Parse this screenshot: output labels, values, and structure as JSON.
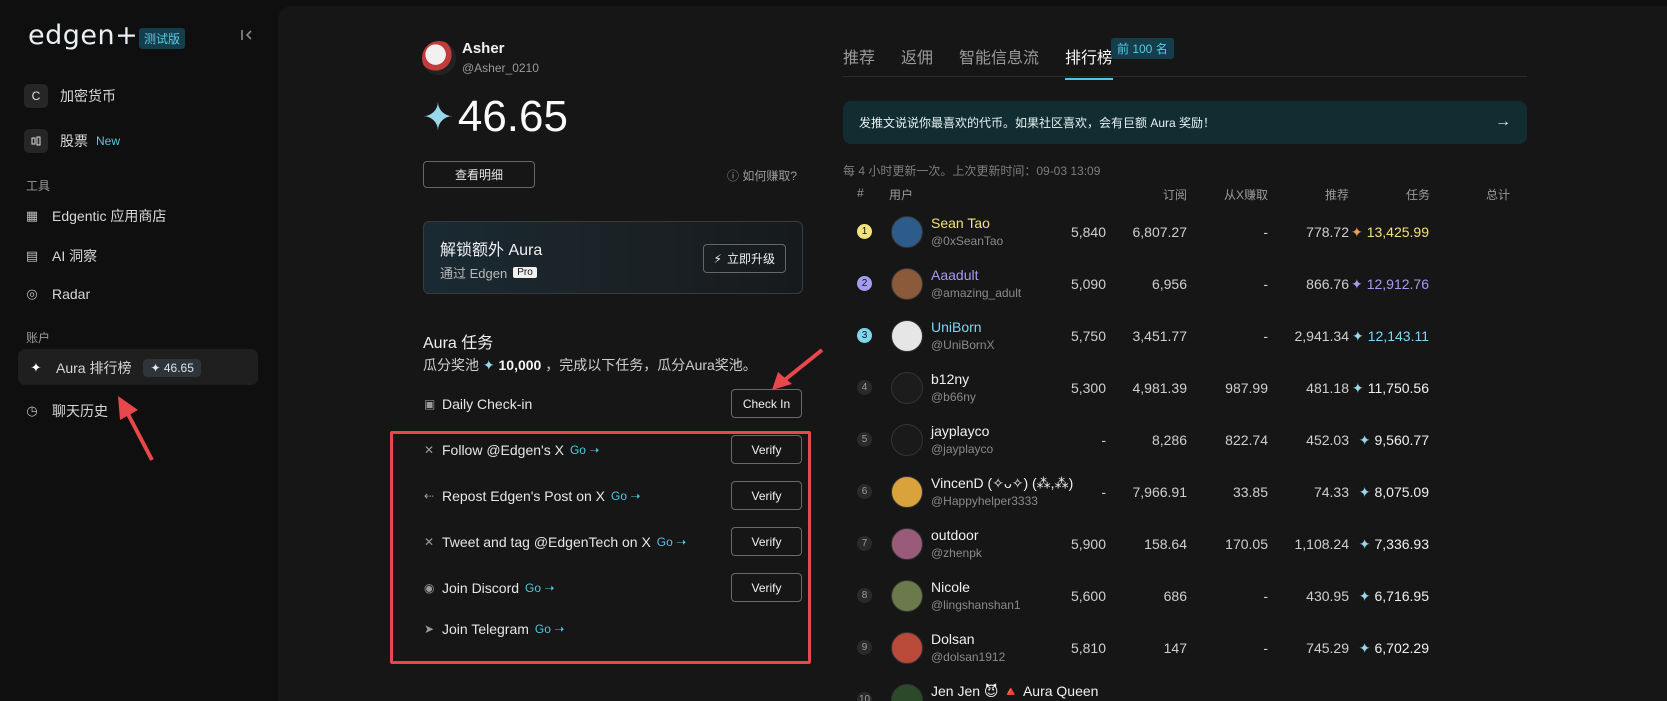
{
  "sidebar": {
    "logo": "edgen+",
    "beta_tag": "测试版",
    "items_top": [
      {
        "label": "加密货币",
        "icon": "crypto-icon"
      },
      {
        "label": "股票",
        "badge": "New",
        "icon": "stock-icon"
      }
    ],
    "section_tools": "工具",
    "tools": [
      {
        "label": "Edgentic 应用商店",
        "icon": "grid-icon"
      },
      {
        "label": "AI 洞察",
        "icon": "insight-icon"
      },
      {
        "label": "Radar",
        "icon": "radar-icon"
      }
    ],
    "section_account": "账户",
    "account": [
      {
        "label": "Aura 排行榜",
        "value": "46.65",
        "icon": "sparkle-icon"
      },
      {
        "label": "聊天历史",
        "icon": "clock-icon"
      }
    ]
  },
  "profile": {
    "name": "Asher",
    "handle": "@Asher_0210",
    "score": "46.65",
    "detail_button": "查看明细",
    "how_to_earn": "如何赚取?"
  },
  "unlock": {
    "title": "解锁额外 Aura",
    "subtitle": "通过 Edgen",
    "pro_tag": "Pro",
    "upgrade_button": "立即升级"
  },
  "tasks": {
    "title": "Aura 任务",
    "desc_prefix": "瓜分奖池",
    "desc_amount": "10,000",
    "desc_suffix": "，完成以下任务，瓜分Aura奖池。",
    "go_label": "Go",
    "items": [
      {
        "label": "Daily Check-in",
        "button": "Check In"
      },
      {
        "label": "Follow @Edgen's X",
        "button": "Verify"
      },
      {
        "label": "Repost Edgen's Post on X",
        "button": "Verify"
      },
      {
        "label": "Tweet and tag @EdgenTech on X",
        "button": "Verify"
      },
      {
        "label": "Join Discord",
        "button": "Verify"
      },
      {
        "label": "Join Telegram"
      }
    ]
  },
  "leaderboard": {
    "tabs": [
      "推荐",
      "返佣",
      "智能信息流",
      "排行榜"
    ],
    "tab_badge": "前 100 名",
    "banner": "发推文说说你最喜欢的代币。如果社区喜欢，会有巨额 Aura 奖励！",
    "update_note": "每 4 小时更新一次。上次更新时间：09-03 13:09",
    "columns": [
      "#",
      "用户",
      "订阅",
      "从X赚取",
      "推荐",
      "任务",
      "总计"
    ],
    "rows": [
      {
        "rank": "1",
        "name": "Sean Tao",
        "handle": "@0xSeanTao",
        "sub": "5,840",
        "x": "6,807.27",
        "rec": "-",
        "task": "778.72",
        "total": "13,425.99",
        "color": "#f3e27a"
      },
      {
        "rank": "2",
        "name": "Aaadult",
        "handle": "@amazing_adult",
        "sub": "5,090",
        "x": "6,956",
        "rec": "-",
        "task": "866.76",
        "total": "12,912.76",
        "color": "#a59cf2"
      },
      {
        "rank": "3",
        "name": "UniBorn",
        "handle": "@UniBornX",
        "sub": "5,750",
        "x": "3,451.77",
        "rec": "-",
        "task": "2,941.34",
        "total": "12,143.11",
        "color": "#7fd6ef"
      },
      {
        "rank": "4",
        "name": "b12ny",
        "handle": "@b66ny",
        "sub": "5,300",
        "x": "4,981.39",
        "rec": "987.99",
        "task": "481.18",
        "total": "11,750.56",
        "color": "#f0f0f0"
      },
      {
        "rank": "5",
        "name": "jayplayco",
        "handle": "@jayplayco",
        "sub": "-",
        "x": "8,286",
        "rec": "822.74",
        "task": "452.03",
        "total": "9,560.77",
        "color": "#f0f0f0"
      },
      {
        "rank": "6",
        "name": "VincenD (✧ᴗ✧) (⁂,⁂)",
        "handle": "@Happyhelper3333",
        "sub": "-",
        "x": "7,966.91",
        "rec": "33.85",
        "task": "74.33",
        "total": "8,075.09",
        "color": "#f0f0f0"
      },
      {
        "rank": "7",
        "name": "outdoor",
        "handle": "@zhenpk",
        "sub": "5,900",
        "x": "158.64",
        "rec": "170.05",
        "task": "1,108.24",
        "total": "7,336.93",
        "color": "#f0f0f0"
      },
      {
        "rank": "8",
        "name": "Nicole",
        "handle": "@lingshanshan1",
        "sub": "5,600",
        "x": "686",
        "rec": "-",
        "task": "430.95",
        "total": "6,716.95",
        "color": "#f0f0f0"
      },
      {
        "rank": "9",
        "name": "Dolsan",
        "handle": "@dolsan1912",
        "sub": "5,810",
        "x": "147",
        "rec": "-",
        "task": "745.29",
        "total": "6,702.29",
        "color": "#f0f0f0"
      },
      {
        "rank": "10",
        "name": "Jen Jen 😈 🔺 Aura Queen",
        "handle": "",
        "sub": "",
        "x": "",
        "rec": "",
        "task": "",
        "total": "",
        "color": "#f0f0f0"
      }
    ]
  },
  "colors": {
    "accent": "#4fc6e6",
    "annotation": "#e8484c"
  }
}
